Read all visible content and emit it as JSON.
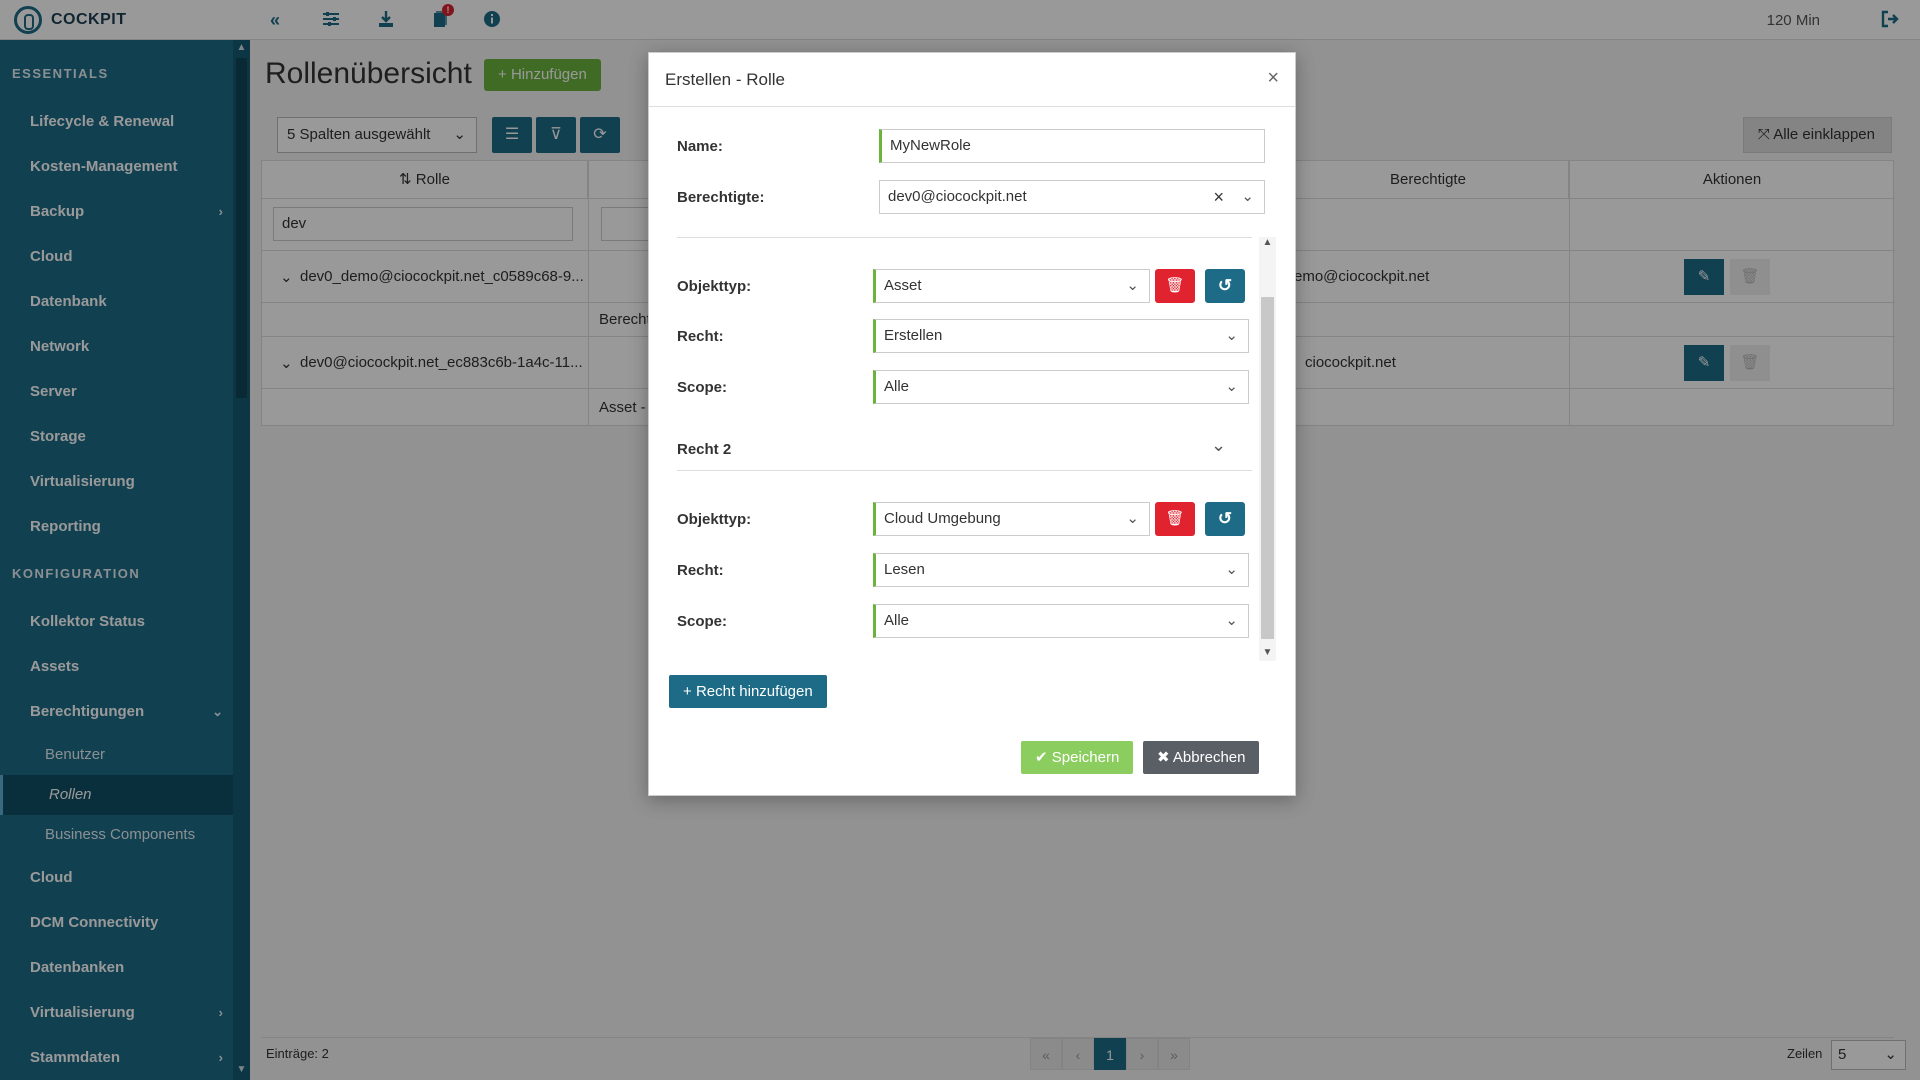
{
  "app": {
    "brand": "COCKPIT",
    "session_timer": "120 Min"
  },
  "topbar": {
    "icons": [
      "double-chevron-left-icon",
      "sliders-icon",
      "download-icon",
      "notifications-icon",
      "info-icon"
    ],
    "notification_badge": "!"
  },
  "sidebar": {
    "section_essentials": "ESSENTIALS",
    "section_konfiguration": "KONFIGURATION",
    "essentials": [
      {
        "label": "Lifecycle & Renewal"
      },
      {
        "label": "Kosten-Management"
      },
      {
        "label": "Backup",
        "has_children": true
      },
      {
        "label": "Cloud"
      },
      {
        "label": "Datenbank"
      },
      {
        "label": "Network"
      },
      {
        "label": "Server"
      },
      {
        "label": "Storage"
      },
      {
        "label": "Virtualisierung"
      },
      {
        "label": "Reporting"
      }
    ],
    "konfiguration": [
      {
        "label": "Kollektor Status"
      },
      {
        "label": "Assets"
      },
      {
        "label": "Berechtigungen",
        "expanded": true
      },
      {
        "label": "Benutzer"
      },
      {
        "label": "Rollen",
        "active": true
      },
      {
        "label": "Business Components"
      },
      {
        "label": "Cloud"
      },
      {
        "label": "DCM Connectivity"
      },
      {
        "label": "Datenbanken"
      },
      {
        "label": "Virtualisierung",
        "has_children": true
      },
      {
        "label": "Stammdaten",
        "has_children": true
      }
    ]
  },
  "page": {
    "title": "Rollenübersicht",
    "add_button": "Hinzufügen",
    "columns_select": "5 Spalten ausgewählt",
    "collapse_all": "Alle einklappen"
  },
  "grid": {
    "headers": {
      "rolle": "Rolle",
      "berechtigte": "Berechtigte",
      "aktionen": "Aktionen"
    },
    "filter_value": "dev",
    "rows": [
      {
        "rolle": "dev0_demo@ciocockpit.net_c0589c68-9...",
        "berechtigte": "emo@ciocockpit.net",
        "detail": "Berecht"
      },
      {
        "rolle": "dev0@ciocockpit.net_ec883c6b-1a4c-11...",
        "berechtigte": "ciocockpit.net",
        "detail": "Asset -"
      }
    ]
  },
  "footer": {
    "entries": "Einträge: 2",
    "current_page": "1",
    "rows_label": "Zeilen",
    "rows_value": "5"
  },
  "modal": {
    "title": "Erstellen - Rolle",
    "name_label": "Name:",
    "name_value": "MyNewRole",
    "berechtigte_label": "Berechtigte:",
    "berechtigte_value": "dev0@ciocockpit.net",
    "rechte": [
      {
        "objekttyp_label": "Objekttyp:",
        "objekttyp": "Asset",
        "recht_label": "Recht:",
        "recht": "Erstellen",
        "scope_label": "Scope:",
        "scope": "Alle"
      },
      {
        "heading": "Recht 2",
        "objekttyp_label": "Objekttyp:",
        "objekttyp": "Cloud Umgebung",
        "recht_label": "Recht:",
        "recht": "Lesen",
        "scope_label": "Scope:",
        "scope": "Alle"
      }
    ],
    "add_recht": "Recht hinzufügen",
    "save": "Speichern",
    "cancel": "Abbrechen"
  },
  "colors": {
    "primary": "#1d6b87",
    "success": "#6cb33e",
    "danger": "#e0232e",
    "neutral": "#5a5f66"
  }
}
